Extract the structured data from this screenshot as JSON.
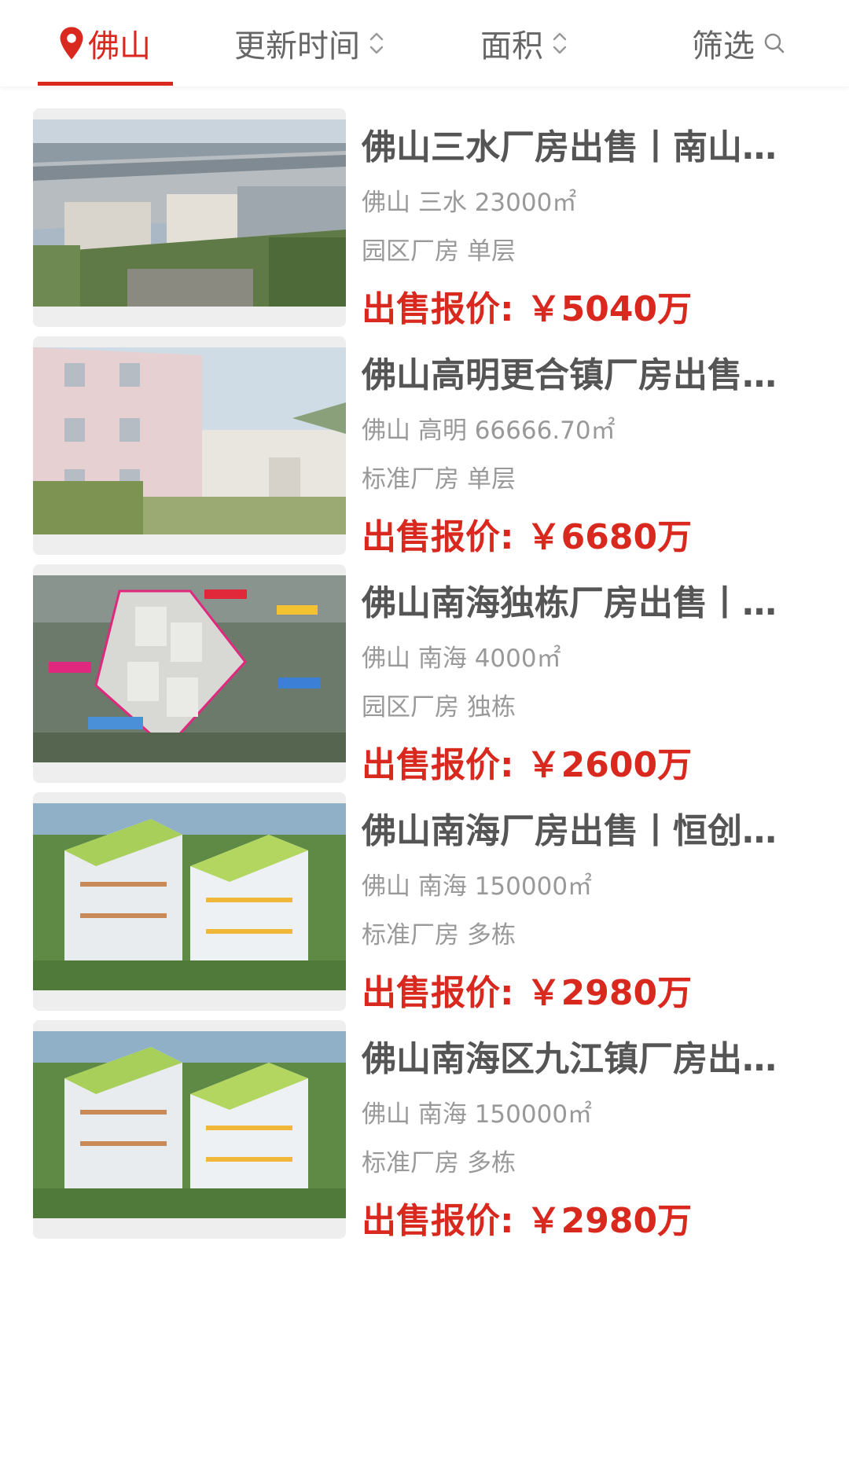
{
  "filter_bar": {
    "city": "佛山",
    "sort_time": "更新时间",
    "sort_area": "面积",
    "filter": "筛选"
  },
  "colors": {
    "accent": "#d9281e",
    "title": "#555555",
    "meta": "#999999"
  },
  "listings": [
    {
      "title": "佛山三水厂房出售丨南山镇工业园厂房",
      "location": "佛山 三水 23000㎡",
      "category": "园区厂房",
      "floors": "单层",
      "price_label": "出售报价:",
      "price": "￥5040万"
    },
    {
      "title": "佛山高明更合镇厂房出售丨标准厂房",
      "location": "佛山 高明 66666.70㎡",
      "category": "标准厂房",
      "floors": "单层",
      "price_label": "出售报价:",
      "price": "￥6680万"
    },
    {
      "title": "佛山南海独栋厂房出售丨产业园",
      "location": "佛山 南海 4000㎡",
      "category": "园区厂房",
      "floors": "独栋",
      "price_label": "出售报价:",
      "price": "￥2600万"
    },
    {
      "title": "佛山南海厂房出售丨恒创产业园",
      "location": "佛山 南海 150000㎡",
      "category": "标准厂房",
      "floors": "多栋",
      "price_label": "出售报价:",
      "price": "￥2980万"
    },
    {
      "title": "佛山南海区九江镇厂房出售丨产业园",
      "location": "佛山 南海 150000㎡",
      "category": "标准厂房",
      "floors": "多栋",
      "price_label": "出售报价:",
      "price": "￥2980万"
    }
  ]
}
